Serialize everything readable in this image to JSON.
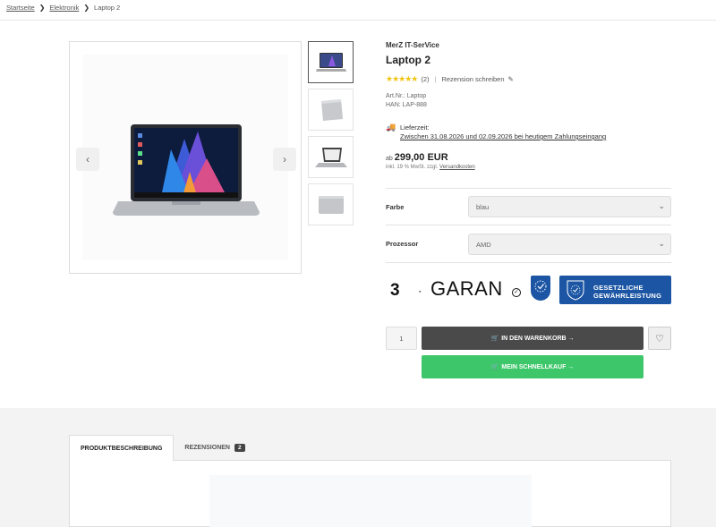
{
  "breadcrumb": {
    "items": [
      "Startseite",
      "Elektronik",
      "Laptop 2"
    ],
    "separator": "❯"
  },
  "gallery": {
    "prev_icon": "‹",
    "next_icon": "›"
  },
  "product": {
    "manufacturer": "MerZ IT-SerVice",
    "title": "Laptop 2",
    "stars": "★★★★★",
    "rating_count": "(2)",
    "review_link": "Rezension schreiben",
    "article_no": "Art.Nr.: Laptop",
    "han": "HAN: LAP-888",
    "delivery_label": "Lieferzeit:",
    "delivery_dates": "Zwischen 31.08.2026 und 02.09.2026 bei heutigem Zahlungseingang",
    "price_prefix": "ab",
    "price": "299,00 EUR",
    "tax_note": "inkl. 19 % MwSt. zzgl.",
    "shipping_link": "Versandkosten"
  },
  "options": {
    "color_label": "Farbe",
    "color_value": "blau",
    "cpu_label": "Prozessor",
    "cpu_value": "AMD"
  },
  "badges": {
    "years": "3",
    "guarantee_text": "GARAN",
    "legal_line1": "GESETZLICHE",
    "legal_line2": "GEWÄHRLEISTUNG"
  },
  "buy": {
    "quantity": "1",
    "cart_label": "IN DEN WARENKORB →",
    "quick_label": "MEIN SCHNELLKAUF →"
  },
  "tabs": [
    {
      "label": "PRODUKTBESCHREIBUNG"
    },
    {
      "label": "REZENSIONEN",
      "count": "2"
    }
  ],
  "colors": {
    "accent_dark": "#4a4a4a",
    "accent_green": "#3ec76a",
    "badge_blue": "#1b55a3",
    "star": "#f1c40f"
  }
}
